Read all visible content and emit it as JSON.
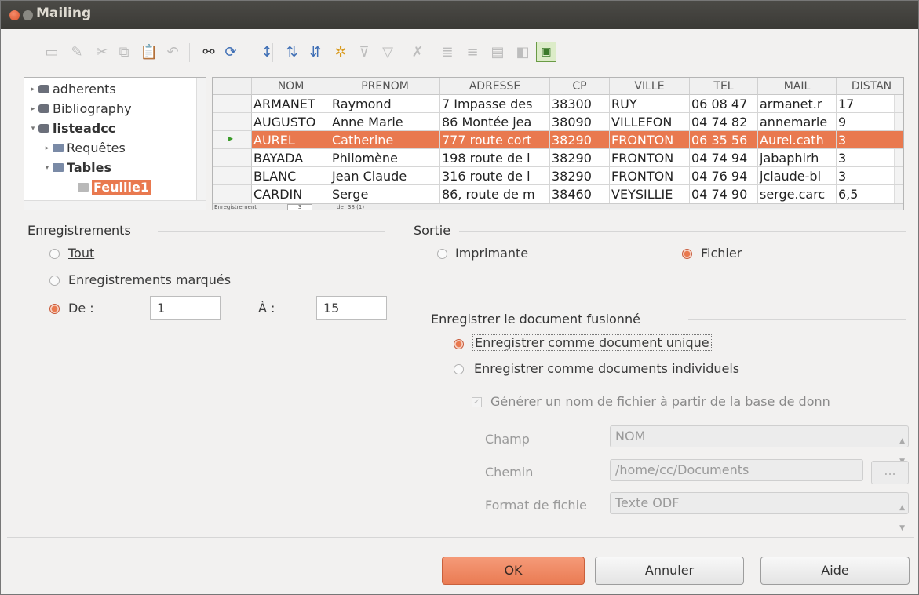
{
  "window": {
    "title": "Mailing"
  },
  "toolbar": {
    "icons": [
      "save-icon",
      "edit-icon",
      "cut-icon",
      "copy-icon",
      "paste-icon",
      "undo-icon",
      "find-icon",
      "refresh-icon",
      "sort-ascending-icon",
      "sort-az-icon",
      "sort-za-icon",
      "autofilter-icon",
      "standard-filter-icon",
      "filter-icon",
      "remove-filter-icon",
      "data-to-text-icon",
      "data-to-fields-icon",
      "mail-merge-icon",
      "data-source-icon",
      "explorer-toggle-icon"
    ]
  },
  "tree": {
    "items": [
      {
        "label": "adherents",
        "bold": false
      },
      {
        "label": "Bibliography",
        "bold": false
      },
      {
        "label": "listeadcc",
        "bold": true
      },
      {
        "label": "Requêtes",
        "bold": false
      },
      {
        "label": "Tables",
        "bold": true
      },
      {
        "label": "Feuille1",
        "bold": true
      }
    ]
  },
  "grid": {
    "columns": [
      "NOM",
      "PRENOM",
      "ADRESSE",
      "CP",
      "VILLE",
      "TEL",
      "MAIL",
      "DISTAN"
    ],
    "rows": [
      [
        "ARMANET",
        "Raymond",
        "7 Impasse des",
        "38300",
        "RUY",
        "06 08 47",
        "armanet.r",
        "17"
      ],
      [
        "AUGUSTO",
        "Anne Marie",
        "86 Montée jea",
        "38090",
        "VILLEFON",
        "04 74 82",
        "annemarie",
        "9"
      ],
      [
        "AUREL",
        "Catherine",
        "777 route cort",
        "38290",
        "FRONTON",
        "06 35 56",
        "Aurel.cath",
        "3"
      ],
      [
        "BAYADA",
        "Philomène",
        "198 route de l",
        "38290",
        "FRONTON",
        "04 74 94",
        "jabaphirh",
        "3"
      ],
      [
        "BLANC",
        "Jean Claude",
        "316 route de l",
        "38290",
        "FRONTON",
        "04 76 94",
        "jclaude-bl",
        "3"
      ],
      [
        "CARDIN",
        "Serge",
        "86, route de m",
        "38460",
        "VEYSILLIE",
        "04 74 90",
        "serge.carc",
        "6,5"
      ]
    ],
    "nav": {
      "record_label": "Enregistrement",
      "record_value": "3",
      "of_label": "de",
      "of_value": "38 (1)"
    }
  },
  "records": {
    "title": "Enregistrements",
    "all": "Tout",
    "marked": "Enregistrements marqués",
    "from": "De :",
    "to": "À :",
    "from_value": "1",
    "to_value": "15"
  },
  "output": {
    "title": "Sortie",
    "printer": "Imprimante",
    "file": "Fichier"
  },
  "save": {
    "title": "Enregistrer le document fusionné",
    "single": "Enregistrer comme document unique",
    "individual": "Enregistrer comme documents individuels",
    "generate": "Générer un nom de fichier à partir de la base de donn",
    "field_label": "Champ",
    "field_value": "NOM",
    "path_label": "Chemin",
    "path_value": "/home/cc/Documents",
    "browse": "...",
    "format_label": "Format de fichie",
    "format_value": "Texte ODF"
  },
  "buttons": {
    "ok": "OK",
    "cancel": "Annuler",
    "help": "Aide"
  },
  "colors": {
    "accent": "#e9794f",
    "titlebar": "#3c3b37"
  }
}
